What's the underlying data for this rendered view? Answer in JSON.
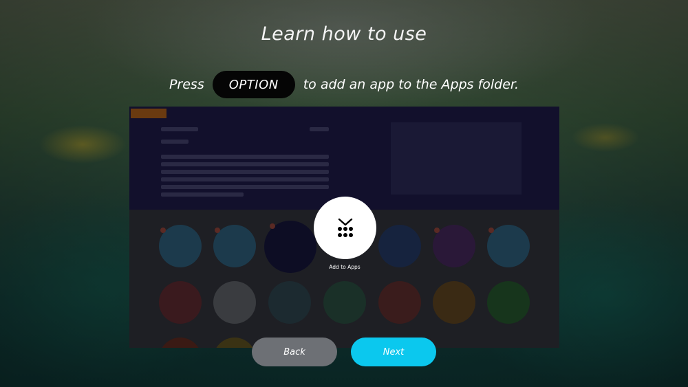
{
  "title": "Learn how to use",
  "instruction": {
    "press_label": "Press",
    "key_label": "OPTION",
    "suffix_label": "to add an app to the Apps folder."
  },
  "add_to_apps": {
    "icon": "add-to-apps-icon",
    "label": "Add to Apps"
  },
  "buttons": {
    "back_label": "Back",
    "next_label": "Next"
  },
  "colors": {
    "next_accent": "#0bc8ee",
    "back_gray": "#6d7075",
    "option_pill": "#050505"
  }
}
